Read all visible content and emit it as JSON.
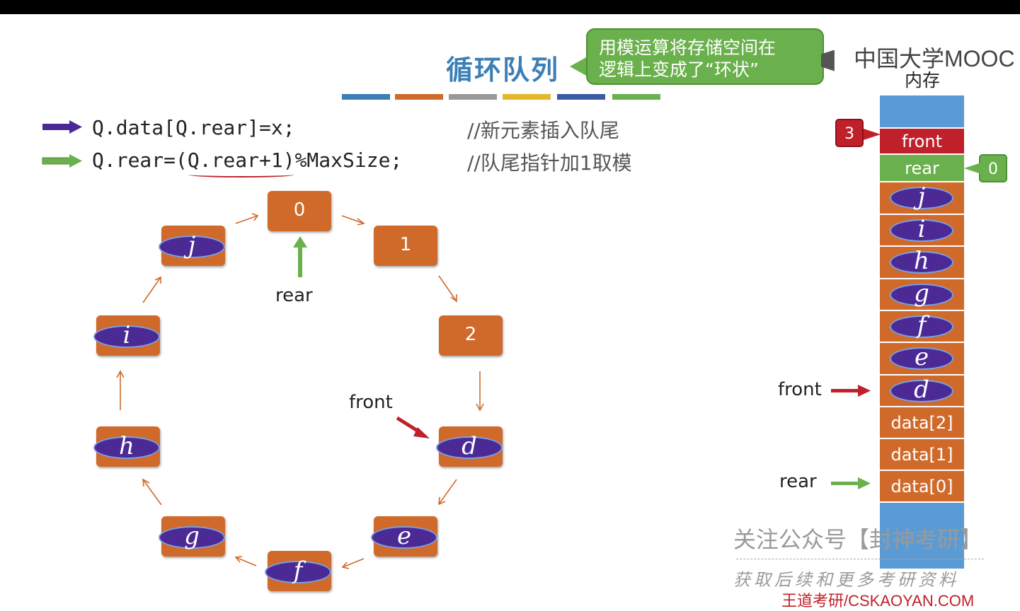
{
  "title": "循环队列",
  "callout": {
    "line1": "用模运算将存储空间在",
    "line2": "逻辑上变成了“环状”"
  },
  "brand": "中国大学MOOC",
  "memory_label": "内存",
  "colors": {
    "orange": "#cf6a2b",
    "purple": "#4b2a96",
    "green": "#6ab04c",
    "red": "#c0202a",
    "blue": "#5b9bd5",
    "title": "#3b7fb6"
  },
  "progress_bar_colors": [
    "#3b7fb6",
    "#cf6a2b",
    "#999999",
    "#e3b82a",
    "#3a5aa8",
    "#6ab04c"
  ],
  "code": [
    {
      "text": "Q.data[Q.rear]=x;",
      "comment": "//新元素插入队尾"
    },
    {
      "text": "Q.rear=(Q.rear+1)%MaxSize;",
      "comment": "//队尾指针加1取模"
    }
  ],
  "ring": {
    "nodes": [
      {
        "index": "0",
        "value": ""
      },
      {
        "index": "1",
        "value": ""
      },
      {
        "index": "2",
        "value": ""
      },
      {
        "index": "",
        "value": "d"
      },
      {
        "index": "",
        "value": "e"
      },
      {
        "index": "",
        "value": "f"
      },
      {
        "index": "",
        "value": "g"
      },
      {
        "index": "",
        "value": "h"
      },
      {
        "index": "",
        "value": "i"
      },
      {
        "index": "",
        "value": "j"
      }
    ],
    "rear_label": "rear",
    "front_label": "front"
  },
  "memory": {
    "header_front": "front",
    "header_rear": "rear",
    "front_value": "3",
    "rear_value": "0",
    "elements": [
      "j",
      "i",
      "h",
      "g",
      "f",
      "e",
      "d"
    ],
    "data_cells": [
      "data[2]",
      "data[1]",
      "data[0]"
    ],
    "front_pointer_label": "front",
    "rear_pointer_label": "rear"
  },
  "watermark": {
    "line1": "关注公众号【封神考研】",
    "line2": "获取后续和更多考研资料",
    "line3": "王道考研/CSKAOYAN.COM"
  }
}
